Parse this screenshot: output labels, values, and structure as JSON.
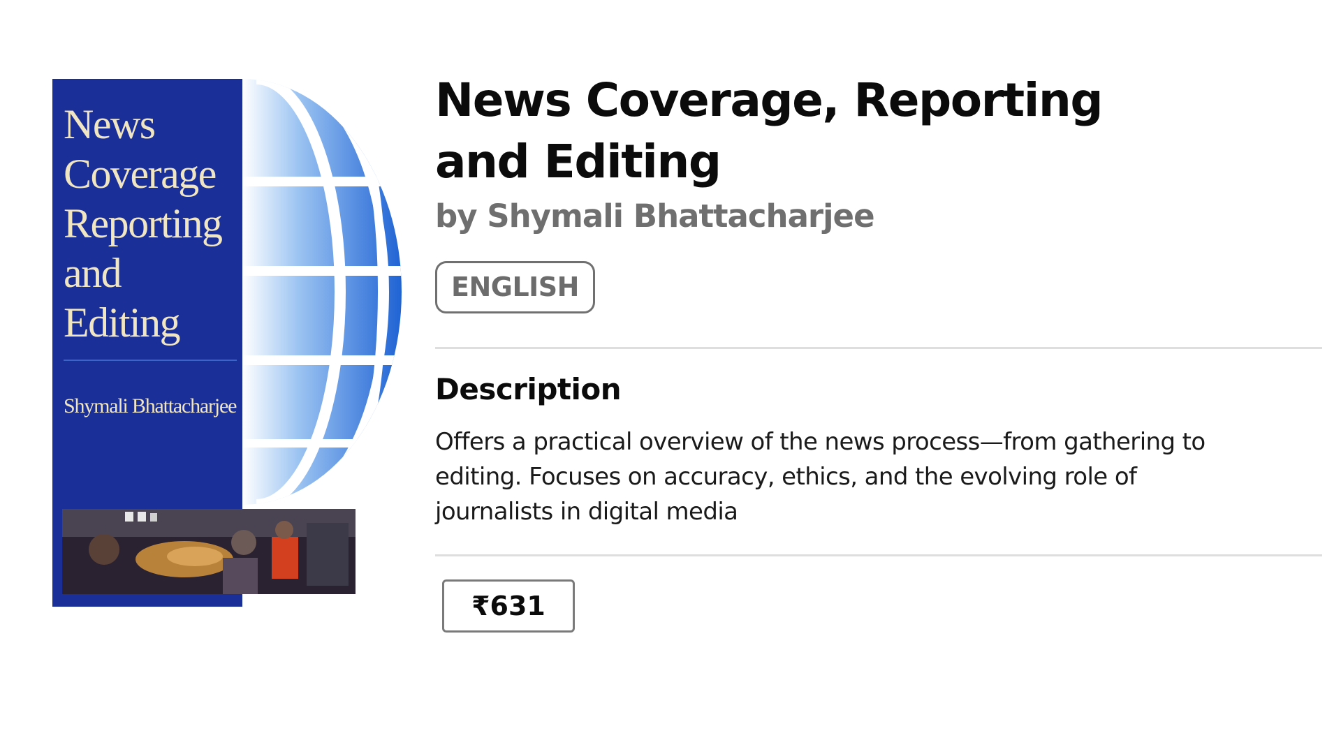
{
  "cover": {
    "title_lines": [
      "News",
      "Coverage",
      "Reporting",
      "and",
      "Editing"
    ],
    "author": "Shymali Bhattacharjee",
    "colors": {
      "panel": "#1b2f98",
      "title_text": "#f1e6c4",
      "globe_blue": "#2a6fd9"
    }
  },
  "book": {
    "title": "News Coverage, Reporting and Editing",
    "author_line": "by Shymali Bhattacharjee",
    "language": "ENGLISH",
    "description_heading": "Description",
    "description": "Offers a practical overview of the news process—from gathering to editing. Focuses on accuracy, ethics, and the evolving role of journalists in digital media",
    "price": "₹631"
  },
  "colors": {
    "title_text": "#0b0b0b",
    "author_text": "#6f6f6f",
    "divider": "#dedede",
    "badge_border": "#707070"
  }
}
